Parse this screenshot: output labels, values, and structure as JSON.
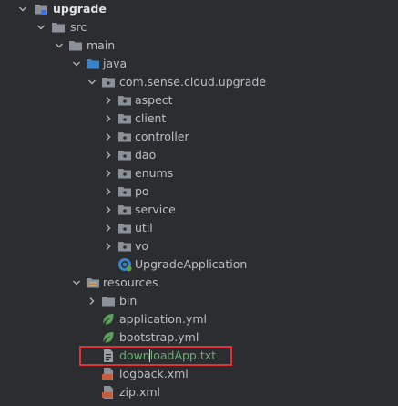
{
  "tree": {
    "project": "upgrade",
    "src": "src",
    "main": "main",
    "java": "java",
    "package": "com.sense.cloud.upgrade",
    "subpackages": [
      "aspect",
      "client",
      "controller",
      "dao",
      "enums",
      "po",
      "service",
      "util",
      "vo"
    ],
    "main_class": "UpgradeApplication",
    "resources": "resources",
    "bin": "bin",
    "files": [
      "application.yml",
      "bootstrap.yml",
      "downloadApp.txt",
      "logback.xml",
      "zip.xml"
    ]
  },
  "colors": {
    "background": "#2b2d30",
    "text": "#bcbec4",
    "folder": "#8c9199",
    "spring_green": "#5aa15a",
    "xml_orange": "#c75d3c",
    "highlight": "#e03232"
  }
}
